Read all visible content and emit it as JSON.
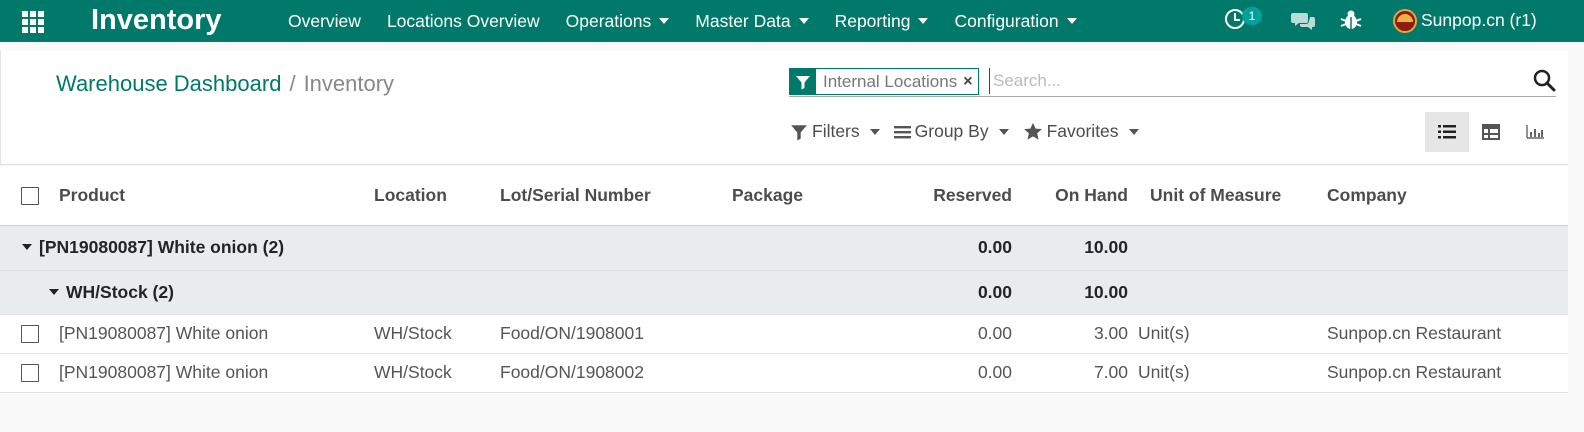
{
  "navbar": {
    "brand": "Inventory",
    "menu": [
      {
        "label": "Overview",
        "dropdown": false
      },
      {
        "label": "Locations Overview",
        "dropdown": false
      },
      {
        "label": "Operations",
        "dropdown": true
      },
      {
        "label": "Master Data",
        "dropdown": true
      },
      {
        "label": "Reporting",
        "dropdown": true
      },
      {
        "label": "Configuration",
        "dropdown": true
      }
    ],
    "activity_count": "1",
    "user": "Sunpop.cn (r1)"
  },
  "breadcrumb": {
    "parent": "Warehouse Dashboard",
    "separator": "/",
    "current": "Inventory"
  },
  "search": {
    "facet": "Internal Locations",
    "facet_remove": "×",
    "placeholder": "Search..."
  },
  "filter_bar": {
    "filters": "Filters",
    "group_by": "Group By",
    "favorites": "Favorites"
  },
  "table": {
    "columns": {
      "product": "Product",
      "location": "Location",
      "lot": "Lot/Serial Number",
      "package": "Package",
      "reserved": "Reserved",
      "on_hand": "On Hand",
      "uom": "Unit of Measure",
      "company": "Company"
    },
    "groups": [
      {
        "label": "[PN19080087] White onion (2)",
        "reserved": "0.00",
        "on_hand": "10.00"
      },
      {
        "label": "WH/Stock (2)",
        "reserved": "0.00",
        "on_hand": "10.00"
      }
    ],
    "rows": [
      {
        "product": "[PN19080087] White onion",
        "location": "WH/Stock",
        "lot": "Food/ON/1908001",
        "package": "",
        "reserved": "0.00",
        "on_hand": "3.00",
        "uom": "Unit(s)",
        "company": "Sunpop.cn Restaurant"
      },
      {
        "product": "[PN19080087] White onion",
        "location": "WH/Stock",
        "lot": "Food/ON/1908002",
        "package": "",
        "reserved": "0.00",
        "on_hand": "7.00",
        "uom": "Unit(s)",
        "company": "Sunpop.cn Restaurant"
      }
    ]
  },
  "colors": {
    "navbar": "#00786a",
    "group_row": "#e9ecef",
    "badge": "#00a09d"
  }
}
